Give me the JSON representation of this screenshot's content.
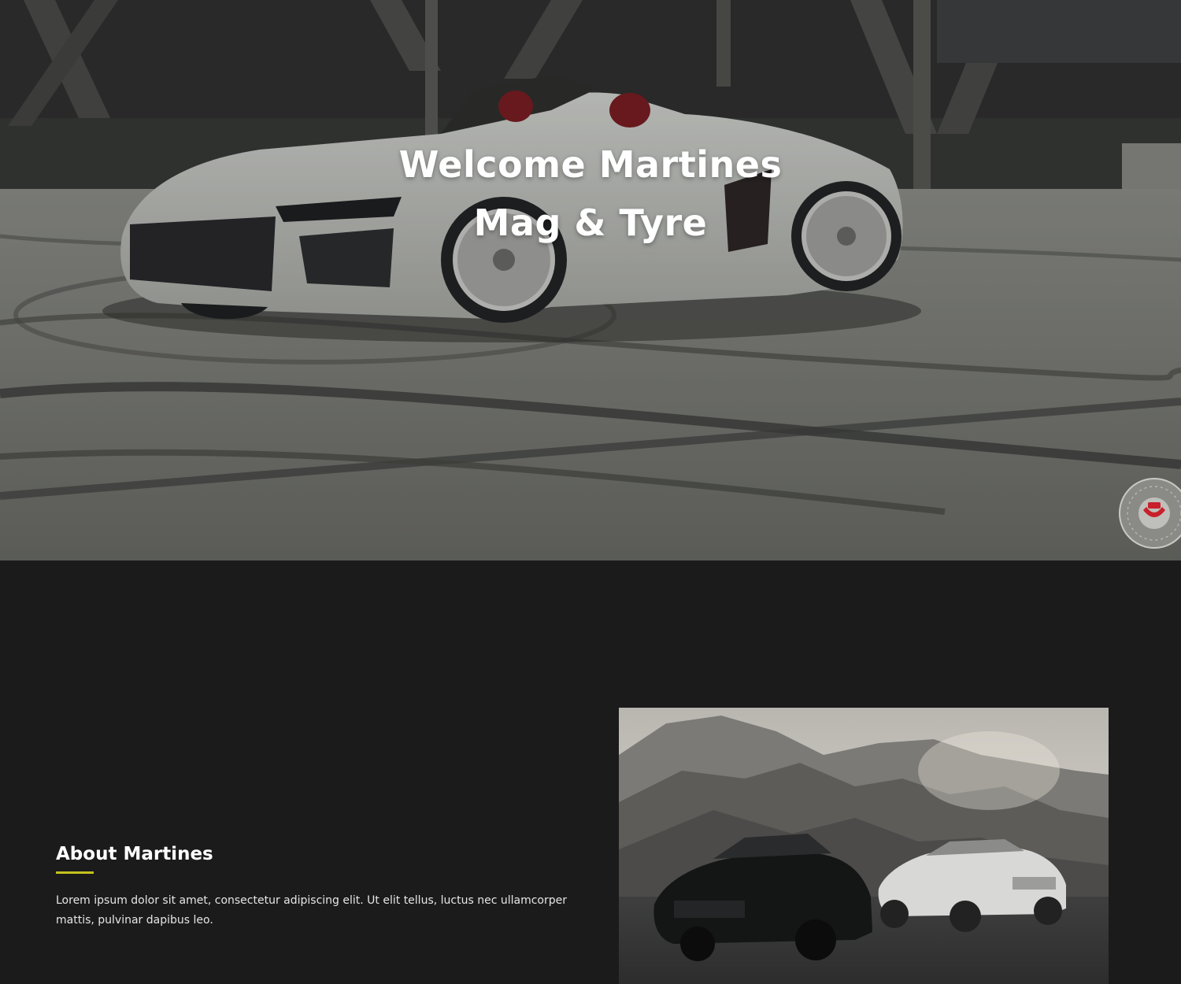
{
  "hero": {
    "title_line1": "Welcome Martines",
    "title_line2": "Mag & Tyre",
    "background_image": "white-convertible-sports-car-photo",
    "badge_icon": "brand-seal-icon"
  },
  "about": {
    "heading": "About Martines",
    "accent_color": "#c3c21e",
    "body": "Lorem ipsum dolor sit amet, consectetur adipiscing elit. Ut elit tellus, luctus nec ullamcorper mattis, pulvinar dapibus leo.",
    "image": "two-sedans-mountain-sunset-photo"
  },
  "colors": {
    "page_background": "#1b1b1b",
    "hero_text": "#ffffff"
  }
}
